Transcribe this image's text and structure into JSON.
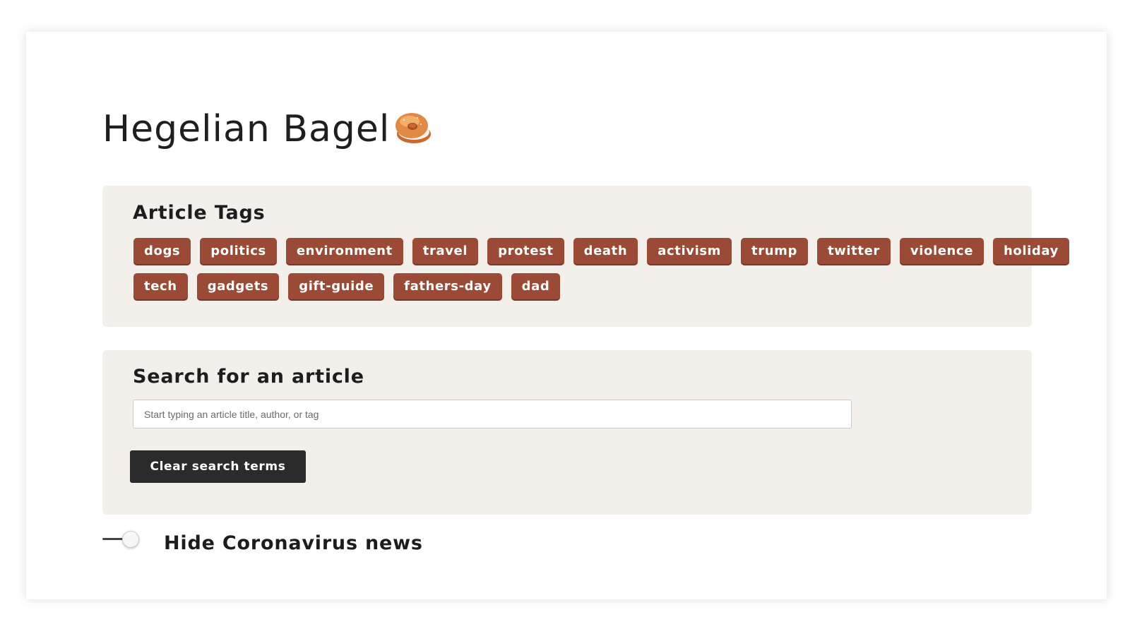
{
  "header": {
    "title": "Hegelian Bagel",
    "icon": "bagel-icon"
  },
  "tags_section": {
    "heading": "Article Tags",
    "tags": [
      "dogs",
      "politics",
      "environment",
      "travel",
      "protest",
      "death",
      "activism",
      "trump",
      "twitter",
      "violence",
      "holiday",
      "tech",
      "gadgets",
      "gift-guide",
      "fathers-day",
      "dad"
    ]
  },
  "search_section": {
    "heading": "Search for an article",
    "placeholder": "Start typing an article title, author, or tag",
    "value": "",
    "clear_button_label": "Clear search terms"
  },
  "coronavirus_toggle": {
    "label": "Hide Coronavirus news",
    "enabled": false
  },
  "colors": {
    "tag_background": "#9b4a36",
    "panel_background": "#f3efeb",
    "button_background": "#2b2b2b"
  }
}
